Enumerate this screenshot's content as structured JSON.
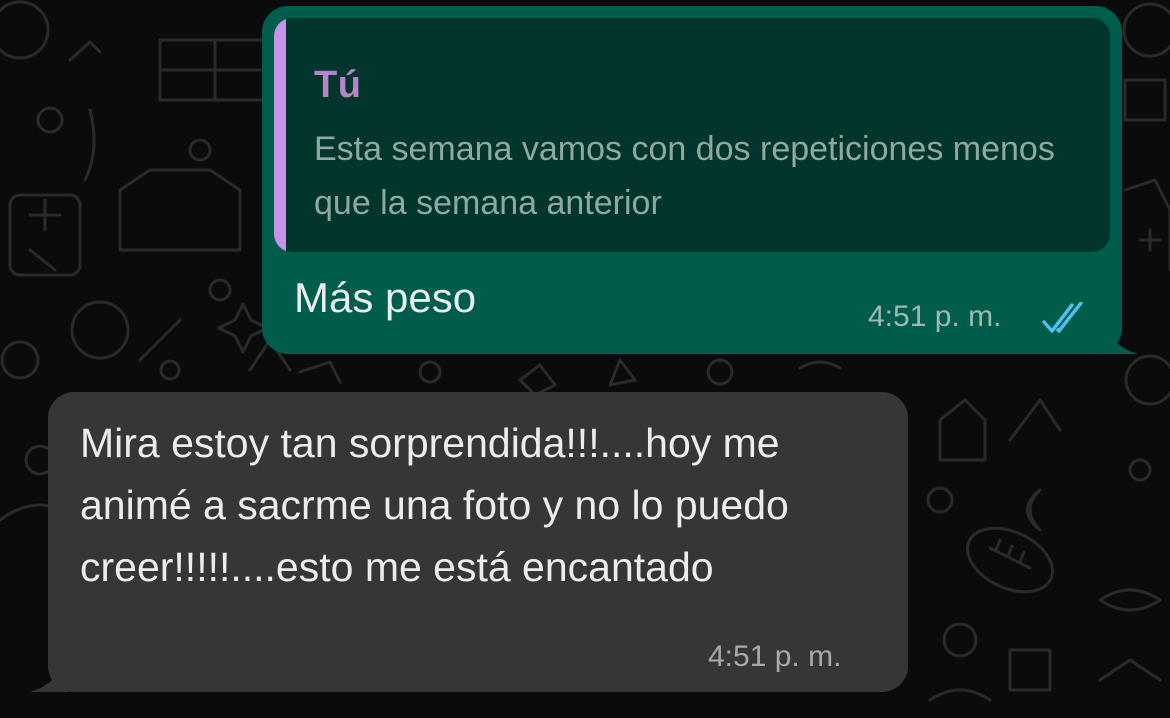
{
  "chat": {
    "outgoing": {
      "quote_author": "Tú",
      "quote_text": "Esta semana vamos con dos repeticiones menos que la semana anterior",
      "text": "Más peso",
      "time": "4:51 p. m.",
      "status_icon": "double-check-read-icon"
    },
    "incoming": {
      "text": "Mira estoy tan sorprendida!!!....hoy me animé a sacrme una foto y no lo puedo creer!!!!!....esto me está encantado",
      "time": "4:51 p. m."
    }
  },
  "colors": {
    "background": "#0b0b0b",
    "outgoing_bubble": "#005c4b",
    "quote_background": "#02352c",
    "quote_bar": "#c792ea",
    "incoming_bubble": "#363636",
    "read_ticks": "#53bdeb"
  }
}
